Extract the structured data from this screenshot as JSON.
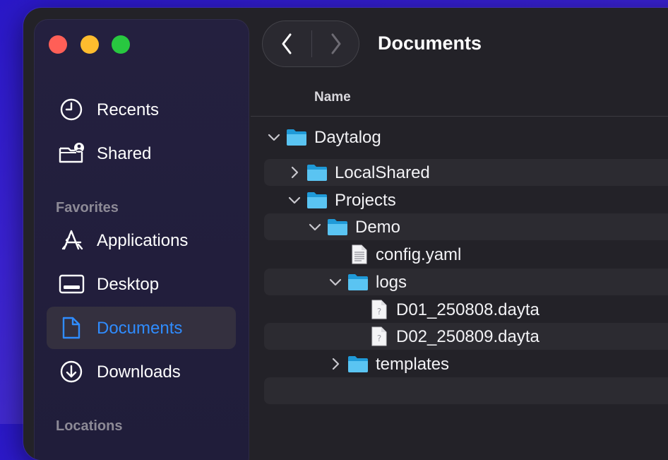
{
  "window": {
    "title": "Documents"
  },
  "sidebar": {
    "top_items": [
      {
        "label": "Recents",
        "icon": "clock-icon"
      },
      {
        "label": "Shared",
        "icon": "shared-folder-icon"
      }
    ],
    "favorites_title": "Favorites",
    "favorites": [
      {
        "label": "Applications",
        "icon": "applications-icon"
      },
      {
        "label": "Desktop",
        "icon": "desktop-icon"
      },
      {
        "label": "Documents",
        "icon": "document-icon",
        "active": true
      },
      {
        "label": "Downloads",
        "icon": "download-icon"
      }
    ],
    "locations_title": "Locations"
  },
  "list": {
    "column_name": "Name",
    "rows": [
      {
        "name": "Daytalog",
        "type": "folder",
        "expanded": true
      },
      {
        "name": "LocalShared",
        "type": "folder",
        "expanded": false
      },
      {
        "name": "Projects",
        "type": "folder",
        "expanded": true
      },
      {
        "name": "Demo",
        "type": "folder",
        "expanded": true
      },
      {
        "name": "config.yaml",
        "type": "text-file"
      },
      {
        "name": "logs",
        "type": "folder",
        "expanded": true
      },
      {
        "name": "D01_250808.dayta",
        "type": "unknown-file"
      },
      {
        "name": "D02_250809.dayta",
        "type": "unknown-file"
      },
      {
        "name": "templates",
        "type": "folder",
        "expanded": false
      },
      {
        "name": "",
        "type": "empty"
      }
    ]
  },
  "colors": {
    "accent": "#2f8cff",
    "folder": "#5ac4f2",
    "traffic_red": "#ff5f57",
    "traffic_yellow": "#febc2e",
    "traffic_green": "#28c840"
  }
}
